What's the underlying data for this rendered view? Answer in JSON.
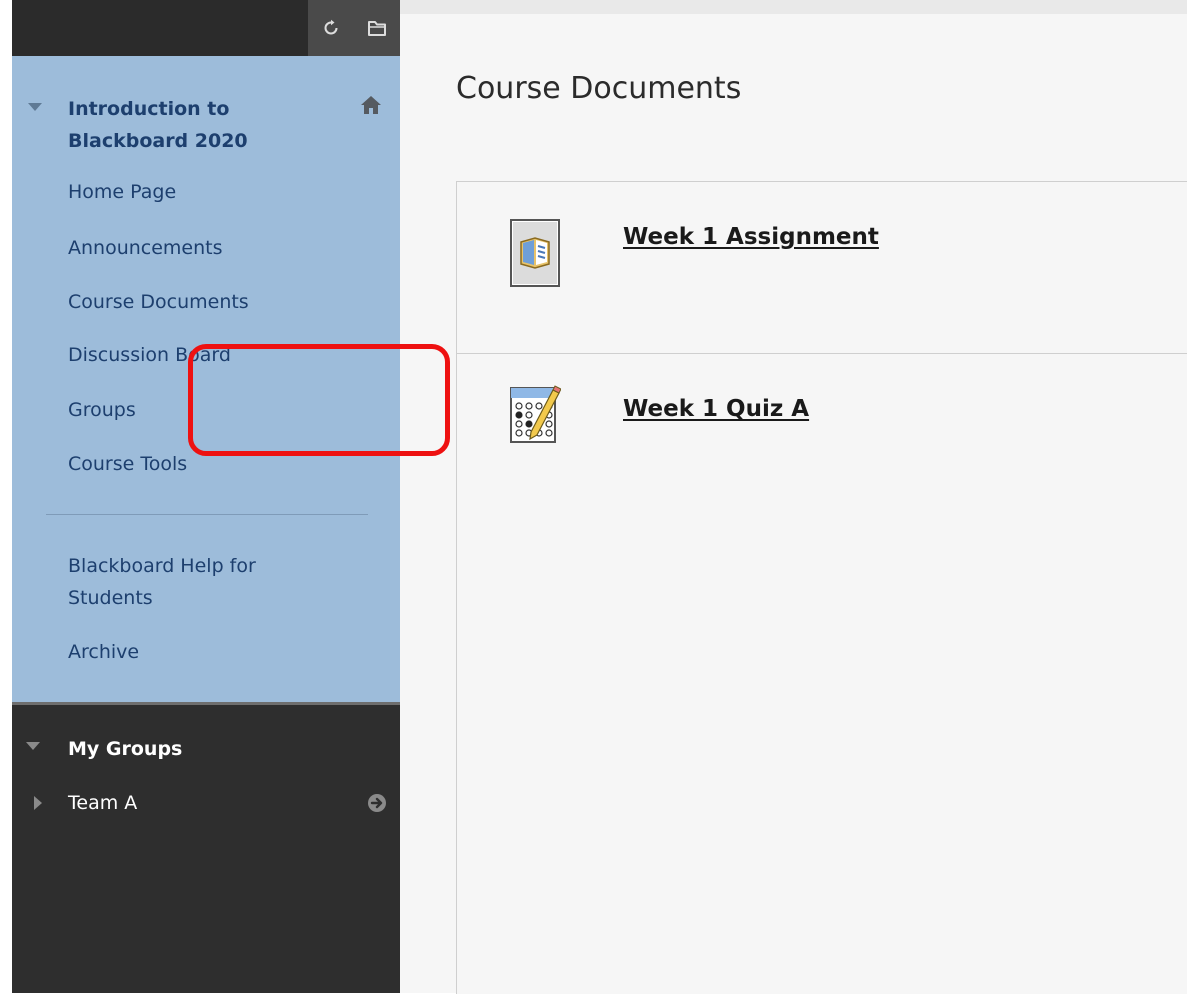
{
  "sidebar": {
    "course_title": "Introduction to Blackboard 2020",
    "nav_items": [
      {
        "label": "Home Page"
      },
      {
        "label": "Announcements"
      },
      {
        "label": "Course Documents"
      },
      {
        "label": "Discussion Board"
      },
      {
        "label": "Groups"
      },
      {
        "label": "Course Tools"
      }
    ],
    "help_items": [
      {
        "label": "Blackboard Help for Students"
      },
      {
        "label": "Archive"
      }
    ],
    "my_groups": {
      "title": "My Groups",
      "groups": [
        {
          "label": "Team A"
        }
      ]
    },
    "icons": {
      "refresh": "refresh-icon",
      "folder": "folder-icon",
      "home": "home-icon"
    }
  },
  "main": {
    "page_title": "Course Documents",
    "items": [
      {
        "title": "Week 1 Assignment",
        "icon": "assignment-icon"
      },
      {
        "title": "Week 1 Quiz A",
        "icon": "quiz-icon"
      }
    ]
  },
  "annotation": {
    "highlight_color": "#ee1111",
    "highlighted_item": "Week 1 Quiz A"
  },
  "colors": {
    "course_panel_bg": "#9dbcda",
    "nav_text": "#1d3f6e",
    "dark_panel_bg": "#2e2e2e"
  }
}
